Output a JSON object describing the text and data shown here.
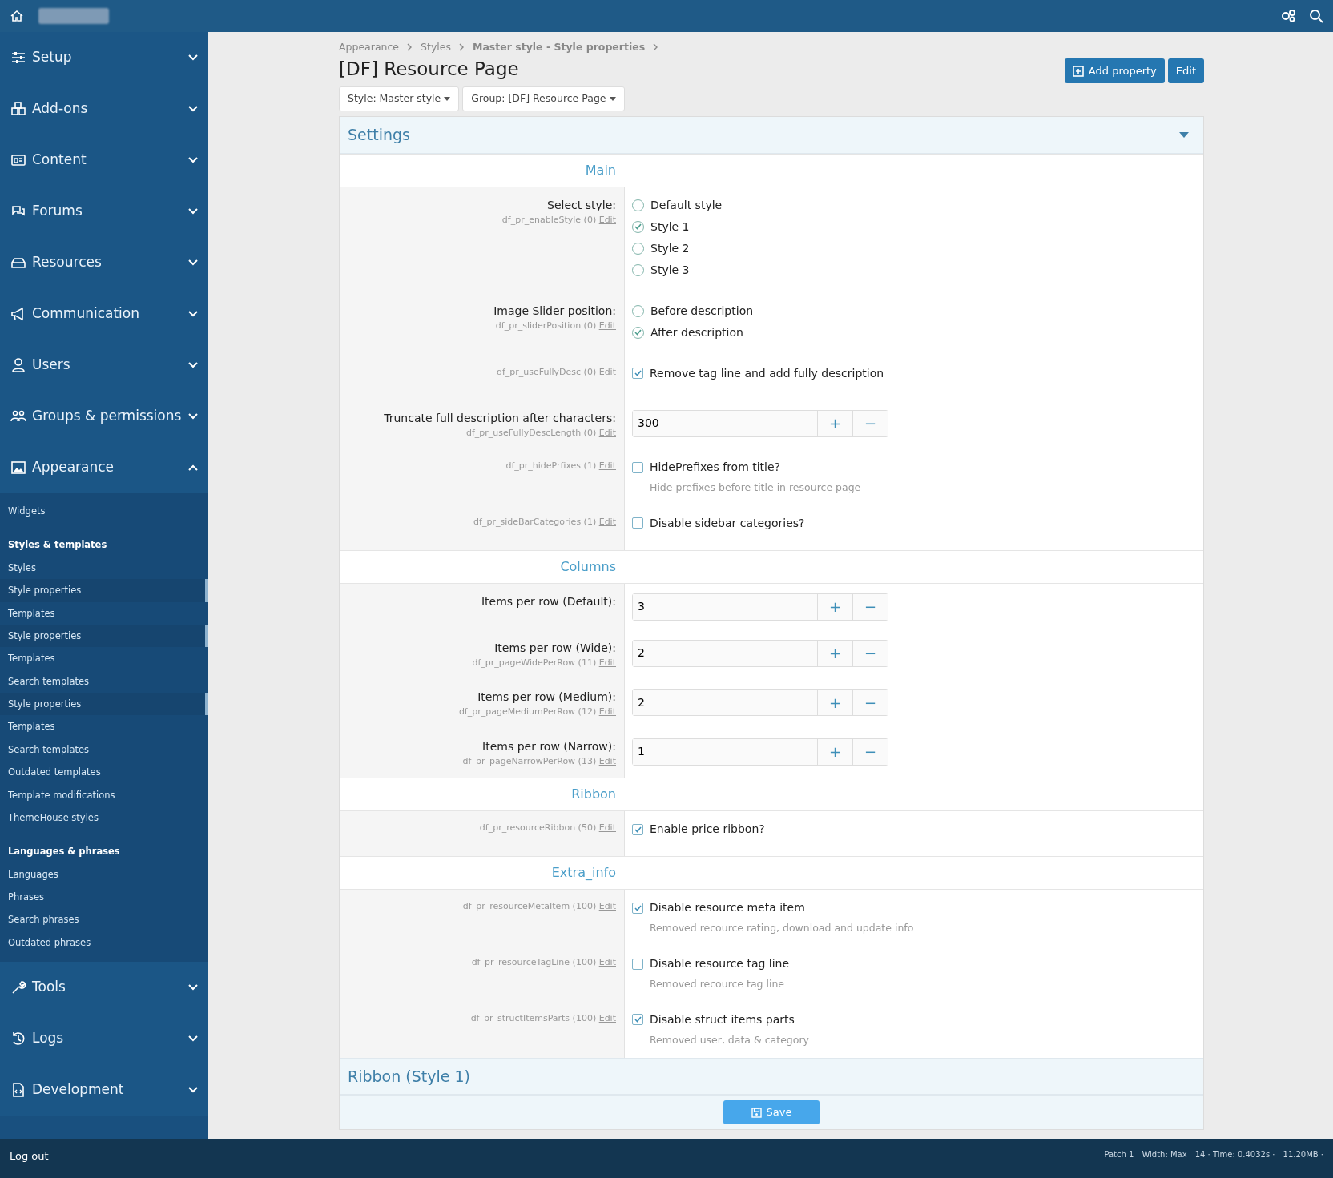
{
  "sidebar": {
    "sections": [
      {
        "label": "Setup",
        "expanded": false
      },
      {
        "label": "Add-ons",
        "expanded": false
      },
      {
        "label": "Content",
        "expanded": false
      },
      {
        "label": "Forums",
        "expanded": false
      },
      {
        "label": "Resources",
        "expanded": false
      },
      {
        "label": "Communication",
        "expanded": false
      },
      {
        "label": "Users",
        "expanded": false
      },
      {
        "label": "Groups & permissions",
        "expanded": false
      },
      {
        "label": "Appearance",
        "expanded": true,
        "children": [
          {
            "label": "Widgets",
            "kind": "link",
            "selected": false
          },
          {
            "label": "Styles & templates",
            "kind": "heading",
            "selected": false
          },
          {
            "label": "Styles",
            "kind": "link",
            "selected": false
          },
          {
            "label": "Style properties",
            "kind": "link",
            "selected": true
          },
          {
            "label": "Templates",
            "kind": "link",
            "selected": false
          },
          {
            "label": "Style properties",
            "kind": "link",
            "selected": true
          },
          {
            "label": "Templates",
            "kind": "link",
            "selected": false
          },
          {
            "label": "Search templates",
            "kind": "link",
            "selected": false
          },
          {
            "label": "Style properties",
            "kind": "link",
            "selected": true
          },
          {
            "label": "Templates",
            "kind": "link",
            "selected": false
          },
          {
            "label": "Search templates",
            "kind": "link",
            "selected": false
          },
          {
            "label": "Outdated templates",
            "kind": "link",
            "selected": false
          },
          {
            "label": "Template modifications",
            "kind": "link",
            "selected": false
          },
          {
            "label": "ThemeHouse styles",
            "kind": "link",
            "selected": false
          },
          {
            "label": "Languages & phrases",
            "kind": "heading",
            "selected": false
          },
          {
            "label": "Languages",
            "kind": "link",
            "selected": false
          },
          {
            "label": "Phrases",
            "kind": "link",
            "selected": false
          },
          {
            "label": "Search phrases",
            "kind": "link",
            "selected": false
          },
          {
            "label": "Outdated phrases",
            "kind": "link",
            "selected": false
          }
        ]
      },
      {
        "label": "Tools",
        "expanded": false
      },
      {
        "label": "Logs",
        "expanded": false
      },
      {
        "label": "Development",
        "expanded": false
      }
    ],
    "logout": "Log out"
  },
  "breadcrumb": [
    "Appearance",
    "Styles",
    "Master style - Style properties"
  ],
  "title": "[DF] Resource Page",
  "actions": [
    {
      "label": "Add property",
      "kind": "add"
    },
    {
      "label": "Edit",
      "kind": "plain"
    }
  ],
  "filters": [
    "Style: Master style",
    "Group: [DF] Resource Page"
  ],
  "panel": {
    "title": "Settings",
    "expanded": true,
    "sections": [
      {
        "title": "Main",
        "rows": [
          {
            "kind": "radio",
            "label": "Select style:",
            "code": "df_pr_enableStyle (0)",
            "edit": "Edit",
            "options": [
              {
                "label": "Default style",
                "selected": false
              },
              {
                "label": "Style 1",
                "selected": true
              },
              {
                "label": "Style 2",
                "selected": false
              },
              {
                "label": "Style 3",
                "selected": false
              }
            ]
          },
          {
            "kind": "radio",
            "label": "Image Slider position:",
            "code": "df_pr_sliderPosition (0)",
            "edit": "Edit",
            "options": [
              {
                "label": "Before description",
                "selected": false
              },
              {
                "label": "After description",
                "selected": true
              }
            ]
          },
          {
            "kind": "checkbox",
            "code": "df_pr_useFullyDesc (0)",
            "edit": "Edit",
            "text": "Remove tag line and add fully description",
            "checked": true
          },
          {
            "kind": "number",
            "label": "Truncate full description after characters:",
            "code": "df_pr_useFullyDescLength (0)",
            "edit": "Edit",
            "value": "300",
            "plus": "+",
            "minus": "−"
          },
          {
            "kind": "checkbox",
            "code": "df_pr_hidePrfixes (1)",
            "edit": "Edit",
            "text": "HidePrefixes from title?",
            "hint": "Hide prefixes before title in resource page",
            "checked": false
          },
          {
            "kind": "checkbox",
            "code": "df_pr_sideBarCategories (1)",
            "edit": "Edit",
            "text": "Disable sidebar categories?",
            "checked": false
          }
        ]
      },
      {
        "title": "Columns",
        "rows": [
          {
            "kind": "number",
            "label": "Items per row (Default):",
            "value": "3",
            "plus": "+",
            "minus": "−"
          },
          {
            "kind": "number",
            "label": "Items per row (Wide):",
            "code": "df_pr_pageWidePerRow (11)",
            "edit": "Edit",
            "value": "2",
            "plus": "+",
            "minus": "−"
          },
          {
            "kind": "number",
            "label": "Items per row (Medium):",
            "code": "df_pr_pageMediumPerRow (12)",
            "edit": "Edit",
            "value": "2",
            "plus": "+",
            "minus": "−"
          },
          {
            "kind": "number",
            "label": "Items per row (Narrow):",
            "code": "df_pr_pageNarrowPerRow (13)",
            "edit": "Edit",
            "value": "1",
            "plus": "+",
            "minus": "−"
          }
        ]
      },
      {
        "title": "Ribbon",
        "rows": [
          {
            "kind": "checkbox",
            "code": "df_pr_resourceRibbon (50)",
            "edit": "Edit",
            "text": "Enable price ribbon?",
            "checked": true
          }
        ]
      },
      {
        "title": "Extra_info",
        "rows": [
          {
            "kind": "checkbox",
            "code": "df_pr_resourceMetaItem (100)",
            "edit": "Edit",
            "text": "Disable resource meta item",
            "hint": "Removed recource rating, download and update info",
            "checked": true
          },
          {
            "kind": "checkbox",
            "code": "df_pr_resourceTagLine (100)",
            "edit": "Edit",
            "text": "Disable resource tag line",
            "hint": "Removed recource tag line",
            "checked": false
          },
          {
            "kind": "checkbox",
            "code": "df_pr_structItemsParts (100)",
            "edit": "Edit",
            "text": "Disable struct items parts",
            "hint": "Removed user, data & category",
            "checked": true
          }
        ]
      }
    ]
  },
  "collapsed_panel": {
    "title": "Ribbon (Style 1)"
  },
  "save": "Save",
  "footer": [
    "Patch 1",
    "Width: Max",
    "14 · Time: 0.4032s ·",
    "11.20MB ·"
  ]
}
